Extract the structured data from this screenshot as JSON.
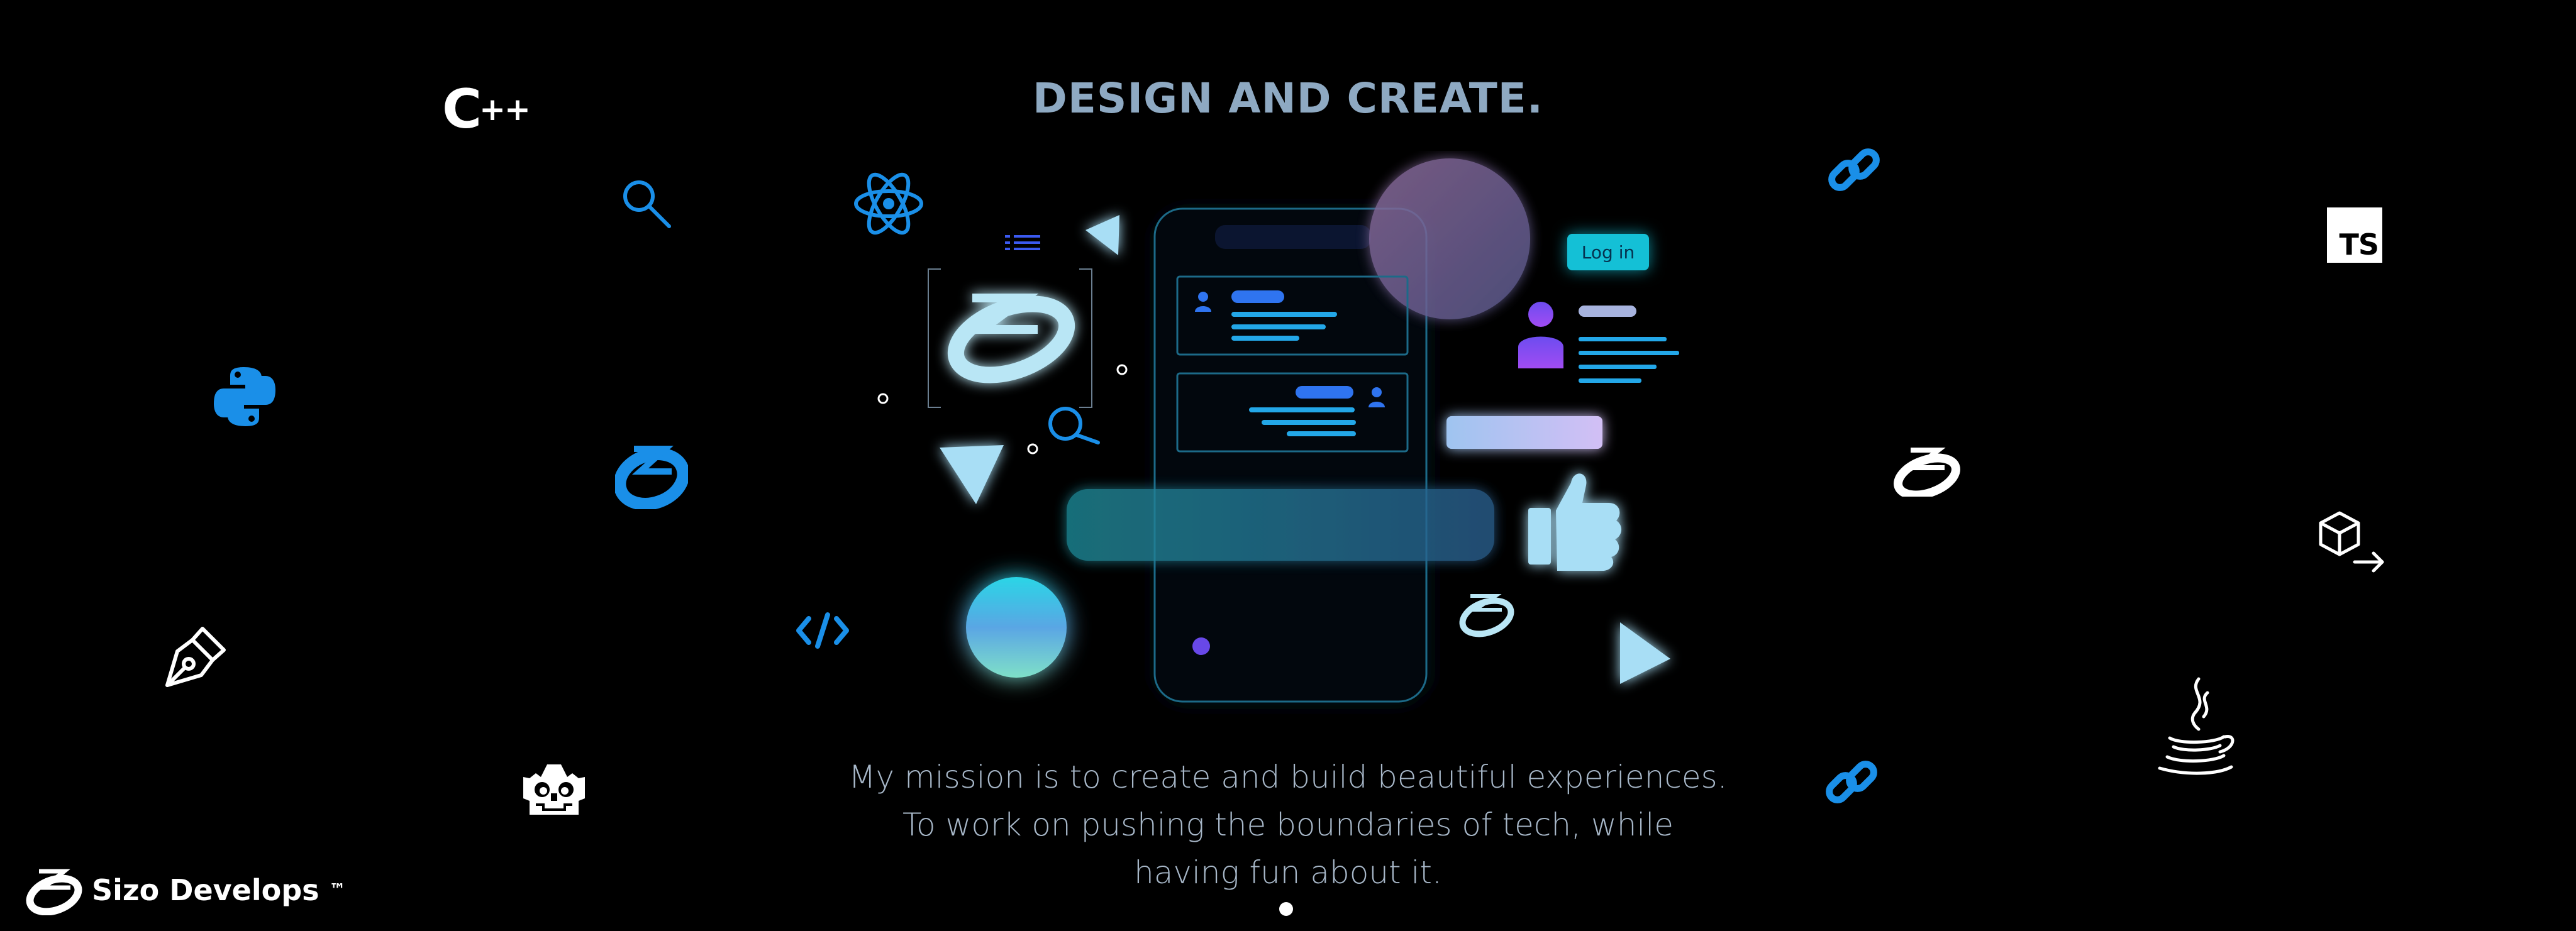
{
  "hero": {
    "heading": "DESIGN AND CREATE.",
    "mission_lines": [
      "My mission is to create and build beautiful experiences.",
      "To work on pushing the boundaries of tech, while",
      "having fun about it."
    ]
  },
  "brand": {
    "name": "Sizo Develops",
    "trademark": "™"
  },
  "illustration": {
    "login_label": "Log in"
  },
  "floating_icons": {
    "cpp_label": "C",
    "cpp_plus": "++",
    "ts_label": "TS",
    "icons": [
      "cpp-icon",
      "search-icon",
      "react-icon",
      "link-icon",
      "typescript-icon",
      "python-icon",
      "sizo-logo-icon",
      "package-arrow-icon",
      "pen-tool-icon",
      "code-icon",
      "godot-icon",
      "java-icon"
    ]
  },
  "carousel": {
    "active_index": 1,
    "count": 1
  },
  "colors": {
    "background": "#000000",
    "heading": "#8ea9c2",
    "text": "#a7b7c8",
    "accent_blue": "#1a8fe8",
    "accent_cyan": "#14c0d6"
  }
}
